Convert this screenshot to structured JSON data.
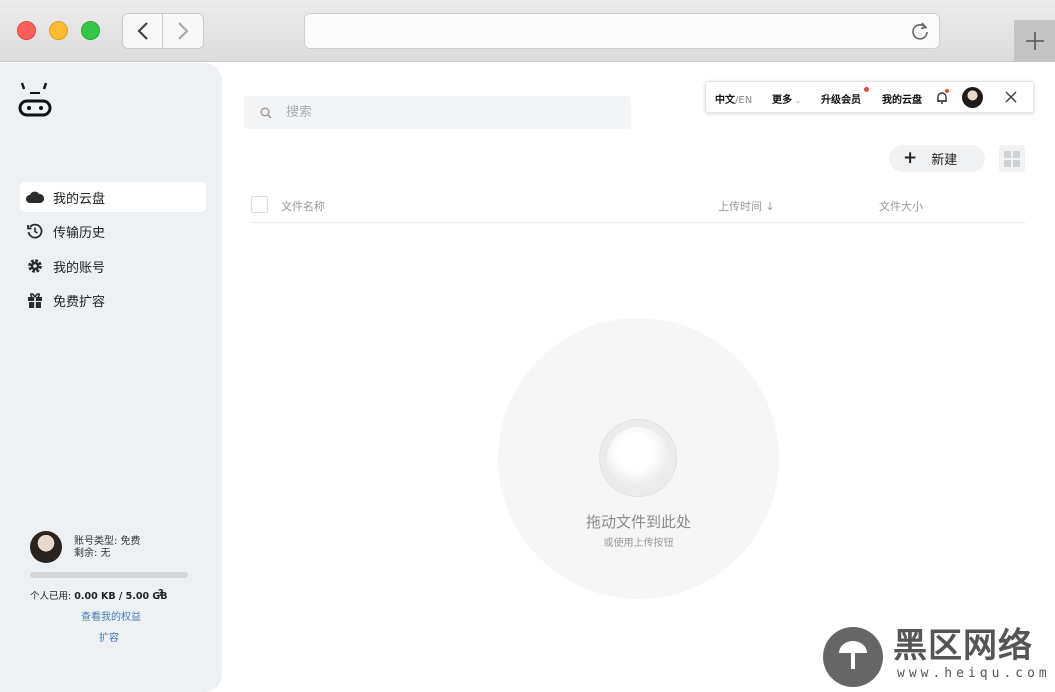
{
  "window": {
    "url": ""
  },
  "sidebar": {
    "items": [
      {
        "label": "我的云盘",
        "icon": "cloud-icon",
        "active": true
      },
      {
        "label": "传输历史",
        "icon": "history-icon",
        "active": false
      },
      {
        "label": "我的账号",
        "icon": "gear-icon",
        "active": false
      },
      {
        "label": "免费扩容",
        "icon": "gift-icon",
        "active": false
      }
    ],
    "account": {
      "type_line": "账号类型: 免费",
      "remaining_line": "剩余: 无",
      "usage_label": "个人已用: ",
      "usage_value": "0.00 KB / 5.00 GB",
      "usage_fraction": 0.0,
      "help": "?",
      "rights_link": "查看我的权益",
      "expand_link": "扩容"
    }
  },
  "search": {
    "placeholder": "搜索"
  },
  "topnav": {
    "lang_zh": "中文",
    "lang_en": "/EN",
    "more": "更多",
    "upgrade": "升级会员",
    "my_cloud": "我的云盘"
  },
  "toolbar": {
    "new_label": "新建"
  },
  "table": {
    "columns": [
      "文件名称",
      "上传时间",
      "文件大小"
    ],
    "sort_indicator": "↓"
  },
  "dropzone": {
    "title": "拖动文件到此处",
    "subtitle": "或使用上传按钮"
  },
  "watermark": {
    "text": "黑区网络",
    "url": "www.heiqu.com"
  },
  "colors": {
    "accent": "#4a90e2",
    "notify_dot": "#e8473c",
    "sidebar_bg": "#eef1f4"
  }
}
